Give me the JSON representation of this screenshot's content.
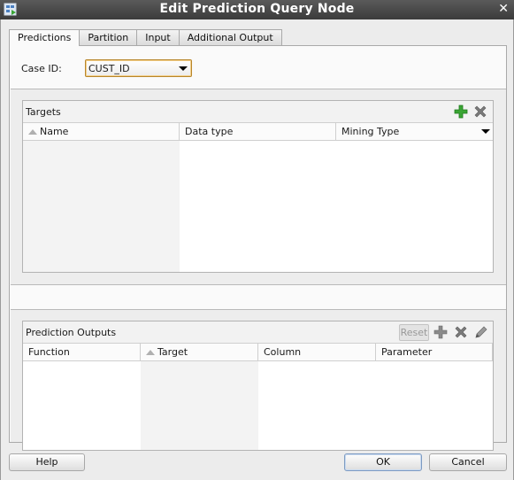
{
  "window": {
    "title": "Edit Prediction Query Node"
  },
  "tabs": [
    {
      "label": "Predictions",
      "active": true
    },
    {
      "label": "Partition",
      "active": false
    },
    {
      "label": "Input",
      "active": false
    },
    {
      "label": "Additional Output",
      "active": false
    }
  ],
  "case_id": {
    "label": "Case ID:",
    "value": "CUST_ID"
  },
  "targets": {
    "title": "Targets",
    "columns": [
      "Name",
      "Data type",
      "Mining Type"
    ],
    "rows": [],
    "actions": {
      "add": "add-icon",
      "remove": "delete-icon"
    }
  },
  "prediction_outputs": {
    "title": "Prediction Outputs",
    "reset_label": "Reset",
    "columns": [
      "Function",
      "Target",
      "Column",
      "Parameter"
    ],
    "rows": [],
    "actions": {
      "add": "add-icon",
      "remove": "delete-icon",
      "edit": "edit-pencil-icon"
    }
  },
  "buttons": {
    "help": "Help",
    "ok": "OK",
    "cancel": "Cancel"
  },
  "colors": {
    "add_green": "#3aa534",
    "titlebar": "#444444",
    "focus_border": "#b8862b"
  }
}
